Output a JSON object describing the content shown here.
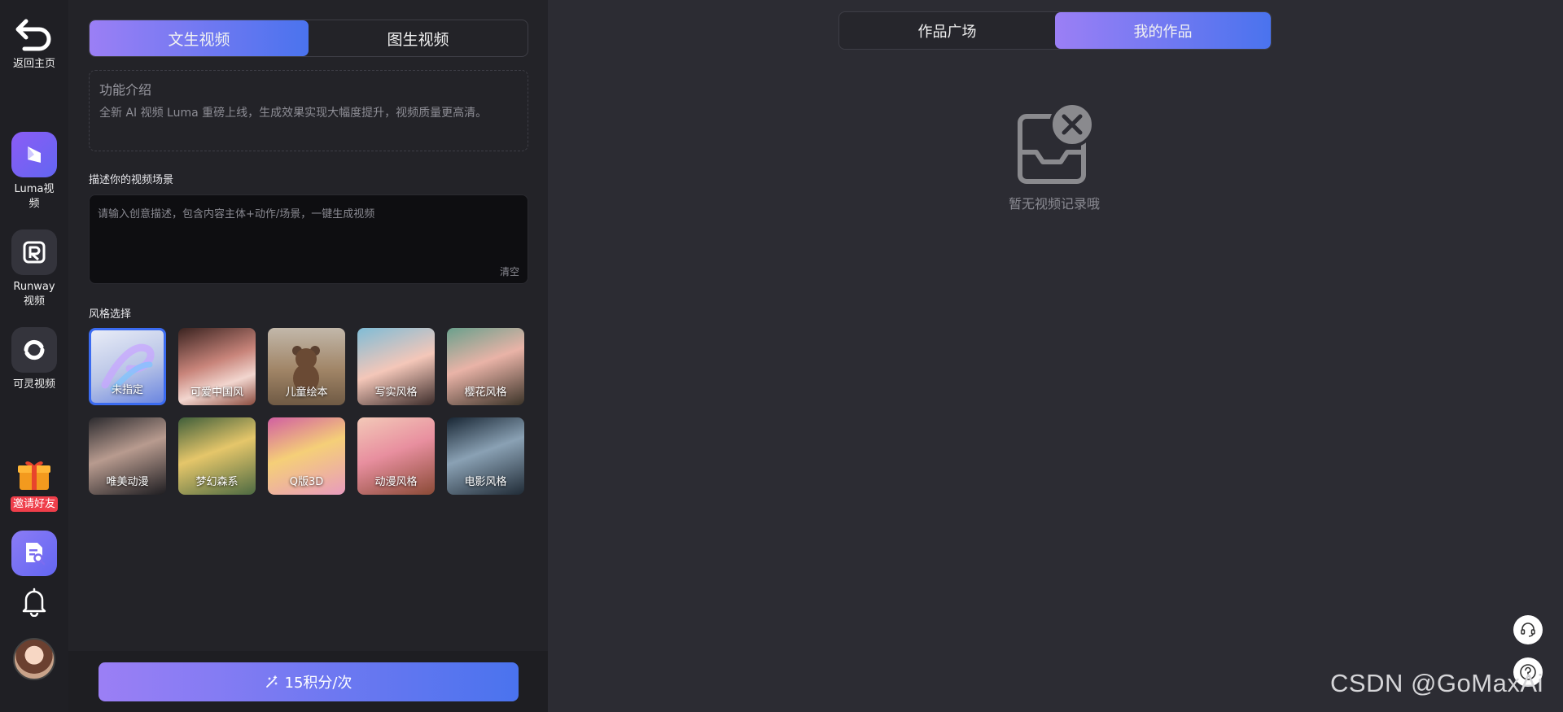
{
  "rail": {
    "home_label": "返回主页",
    "items": [
      {
        "label": "Luma视频",
        "icon": "luma-icon"
      },
      {
        "label": "Runway视频",
        "icon": "runway-icon"
      },
      {
        "label": "可灵视频",
        "icon": "kling-icon"
      }
    ],
    "invite_label": "邀请好友"
  },
  "panel": {
    "tabs": [
      "文生视频",
      "图生视频"
    ],
    "active_tab": 0,
    "intro_title": "功能介绍",
    "intro_text": "全新 AI 视频 Luma 重磅上线，生成效果实现大幅度提升，视频质量更高清。",
    "prompt_label": "描述你的视频场景",
    "prompt_placeholder": "请输入创意描述，包含内容主体+动作/场景，一键生成视频",
    "clear_label": "清空",
    "style_label": "风格选择",
    "styles": [
      "未指定",
      "可爱中国风",
      "儿童绘本",
      "写实风格",
      "樱花风格",
      "唯美动漫",
      "梦幻森系",
      "Q版3D",
      "动漫风格",
      "电影风格"
    ],
    "selected_style": 0,
    "generate_label": "15积分/次"
  },
  "main": {
    "tabs": [
      "作品广场",
      "我的作品"
    ],
    "active_tab": 1,
    "empty_text": "暂无视频记录哦"
  },
  "watermark": "CSDN @GoMaxAi",
  "colors": {
    "accent_start": "#9b7ff5",
    "accent_end": "#4a73ee",
    "invite_badge": "#ef3e4a",
    "selected_border": "#3b6bf0"
  }
}
